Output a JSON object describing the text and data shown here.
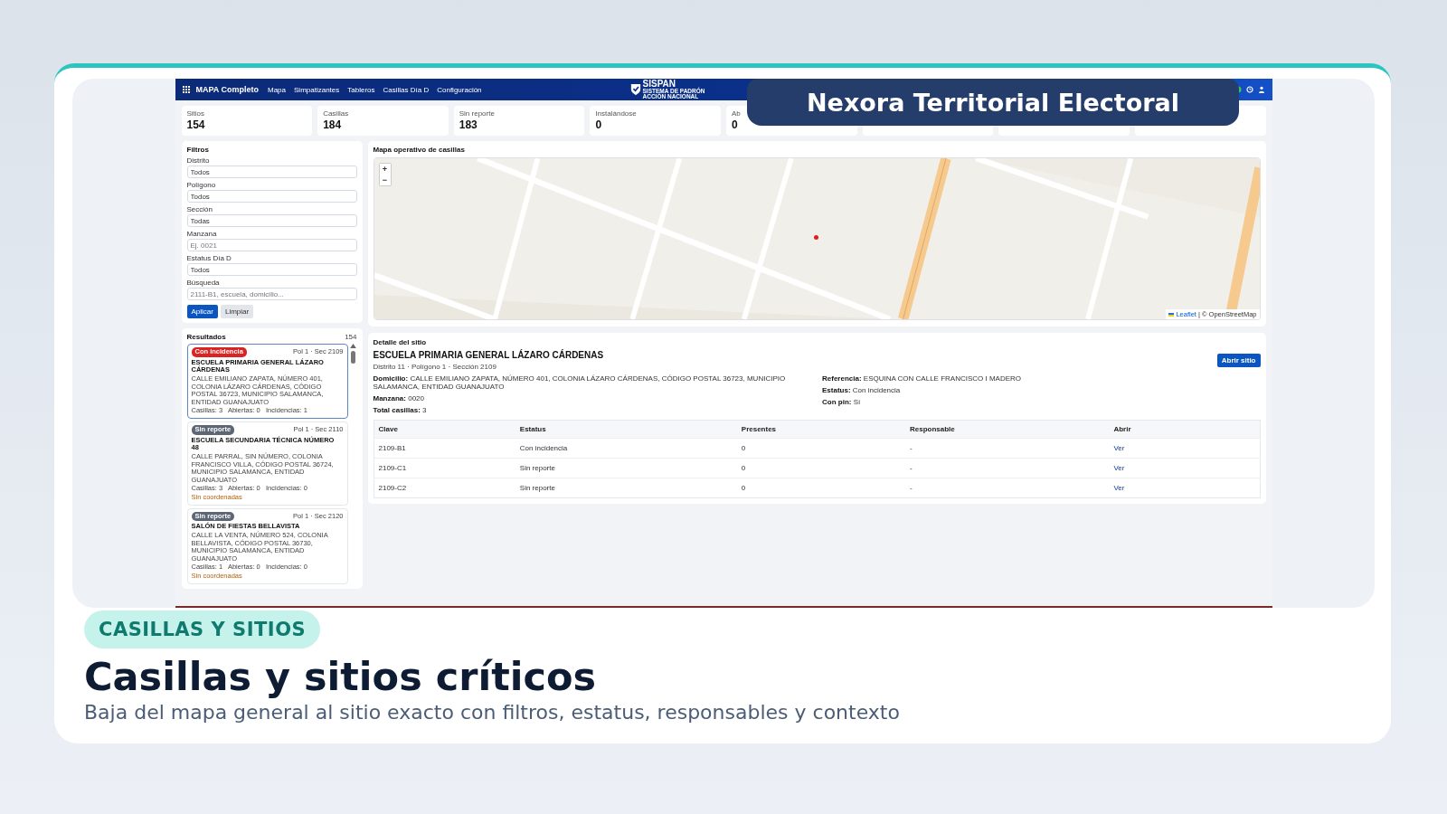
{
  "banner": {
    "title": "Nexora Territorial Electoral"
  },
  "app": {
    "brand": "MAPA Completo",
    "nav": [
      {
        "label": "Mapa"
      },
      {
        "label": "Simpatizantes"
      },
      {
        "label": "Tableros"
      },
      {
        "label": "Casillas Día D"
      },
      {
        "label": "Configuración"
      }
    ],
    "logo": {
      "name": "SISPAN",
      "subtitle_1": "SISTEMA DE PADRÓN",
      "subtitle_2": "ACCIÓN NACIONAL"
    },
    "stats": [
      {
        "label": "Sitios",
        "value": "154"
      },
      {
        "label": "Casillas",
        "value": "184"
      },
      {
        "label": "Sin reporte",
        "value": "183"
      },
      {
        "label": "Instalándose",
        "value": "0"
      },
      {
        "label": "Ab",
        "value": "0"
      }
    ],
    "filters": {
      "title": "Filtros",
      "fields": [
        {
          "label": "Distrito",
          "value": "Todos"
        },
        {
          "label": "Polígono",
          "value": "Todos"
        },
        {
          "label": "Sección",
          "value": "Todas"
        },
        {
          "label": "Manzana",
          "placeholder": "Ej. 0021"
        },
        {
          "label": "Estatus Día D",
          "value": "Todos"
        },
        {
          "label": "Búsqueda",
          "placeholder": "2111-B1, escuela, domicilio..."
        }
      ],
      "apply": "Aplicar",
      "clear": "Limpiar"
    },
    "results": {
      "title": "Resultados",
      "count": "154",
      "items": [
        {
          "status": "Con incidencia",
          "kind": "incident",
          "meta": "Pol 1 · Sec 2109",
          "name": "ESCUELA PRIMARIA GENERAL LÁZARO CÁRDENAS",
          "address": "CALLE EMILIANO ZAPATA, NÚMERO 401, COLONIA LÁZARO CÁRDENAS, CÓDIGO POSTAL 36723, MUNICIPIO SALAMANCA, ENTIDAD GUANAJUATO",
          "counts": "Casillas: 3   Abiertas: 0   Incidencias: 1",
          "selected": true
        },
        {
          "status": "Sin reporte",
          "kind": "noreport",
          "meta": "Pol 1 · Sec 2110",
          "name": "ESCUELA SECUNDARIA TÉCNICA NÚMERO 48",
          "address": "CALLE PARRAL, SIN NÚMERO, COLONIA FRANCISCO VILLA, CÓDIGO POSTAL 36724, MUNICIPIO SALAMANCA, ENTIDAD GUANAJUATO",
          "counts": "Casillas: 3   Abiertas: 0   Incidencias: 0",
          "warning": "Sin coordenadas",
          "selected": false
        },
        {
          "status": "Sin reporte",
          "kind": "noreport",
          "meta": "Pol 1 · Sec 2120",
          "name": "SALÓN DE FIESTAS BELLAVISTA",
          "address": "CALLE LA VENTA, NÚMERO 524, COLONIA BELLAVISTA, CÓDIGO POSTAL 36730, MUNICIPIO SALAMANCA, ENTIDAD GUANAJUATO",
          "counts": "Casillas: 1   Abiertas: 0   Incidencias: 0",
          "warning": "Sin coordenadas",
          "selected": false
        }
      ]
    },
    "map": {
      "title": "Mapa operativo de casillas",
      "zoom_in": "+",
      "zoom_out": "−",
      "attribution_link": "Leaflet",
      "attribution": "| © OpenStreetMap"
    },
    "detail": {
      "title": "Detalle del sitio",
      "name": "ESCUELA PRIMARIA GENERAL LÁZARO CÁRDENAS",
      "subtitle": "Distrito 11 · Polígono 1 · Sección 2109",
      "open": "Abrir sitio",
      "left": [
        {
          "label": "Domicilio:",
          "value": "CALLE EMILIANO ZAPATA, NÚMERO 401, COLONIA LÁZARO CÁRDENAS, CÓDIGO POSTAL 36723, MUNICIPIO SALAMANCA, ENTIDAD GUANAJUATO"
        },
        {
          "label": "Manzana:",
          "value": "0020"
        },
        {
          "label": "Total casillas:",
          "value": "3"
        }
      ],
      "right": [
        {
          "label": "Referencia:",
          "value": "ESQUINA CON CALLE FRANCISCO I MADERO"
        },
        {
          "label": "Estatus:",
          "value": "Con incidencia"
        },
        {
          "label": "Con pin:",
          "value": "Sí"
        }
      ],
      "table": {
        "columns": [
          "Clave",
          "Estatus",
          "Presentes",
          "Responsable",
          "Abrir"
        ],
        "rows": [
          [
            "2109-B1",
            "Con incidencia",
            "0",
            "-",
            "Ver"
          ],
          [
            "2109-C1",
            "Sin reporte",
            "0",
            "-",
            "Ver"
          ],
          [
            "2109-C2",
            "Sin reporte",
            "0",
            "-",
            "Ver"
          ]
        ]
      }
    }
  },
  "tag": "CASILLAS Y SITIOS",
  "title": "Casillas y sitios críticos",
  "subtitle": "Baja del mapa general al sitio exacto con filtros, estatus, responsables y contexto"
}
